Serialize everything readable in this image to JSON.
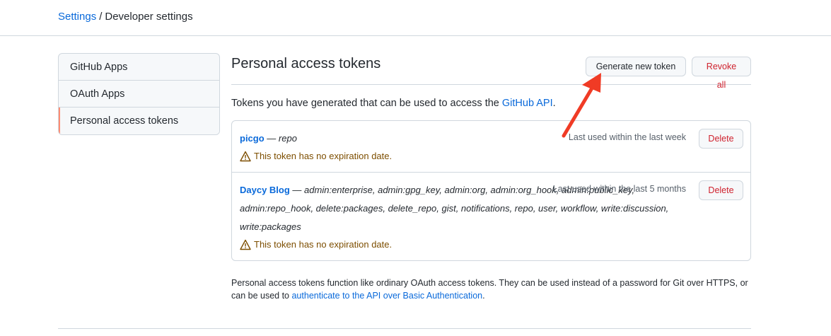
{
  "breadcrumb": {
    "parent": "Settings",
    "separator": "/",
    "current": "Developer settings"
  },
  "sidebar": {
    "items": [
      {
        "label": "GitHub Apps"
      },
      {
        "label": "OAuth Apps"
      },
      {
        "label": "Personal access tokens",
        "selected": true
      }
    ]
  },
  "main": {
    "title": "Personal access tokens",
    "generate_label": "Generate new token",
    "revoke_label": "Revoke all",
    "intro_text": "Tokens you have generated that can be used to access the ",
    "intro_link": "GitHub API",
    "intro_end": ".",
    "tokens": [
      {
        "name": "picgo",
        "dash": " — ",
        "scopes": "repo",
        "last_used": "Last used within the last week",
        "delete_label": "Delete",
        "warning": "This token has no expiration date."
      },
      {
        "name": "Daycy Blog",
        "dash": " — ",
        "scopes": "admin:enterprise, admin:gpg_key, admin:org, admin:org_hook, admin:public_key, admin:repo_hook, delete:packages, delete_repo, gist, notifications, repo, user, workflow, write:discussion, write:packages",
        "last_used": "Last used within the last 5 months",
        "delete_label": "Delete",
        "warning": "This token has no expiration date."
      }
    ],
    "note_text": "Personal access tokens function like ordinary OAuth access tokens. They can be used instead of a password for Git over HTTPS, or can be used to ",
    "note_link": "authenticate to the API over Basic Authentication",
    "note_end": "."
  },
  "colors": {
    "link": "#0969da",
    "danger": "#cf222e",
    "warning": "#7d4e00",
    "selected_marker": "#fd8c73",
    "annotation_arrow": "#f03b25"
  },
  "icons": [
    "alert-icon",
    "arrow-annotation"
  ]
}
